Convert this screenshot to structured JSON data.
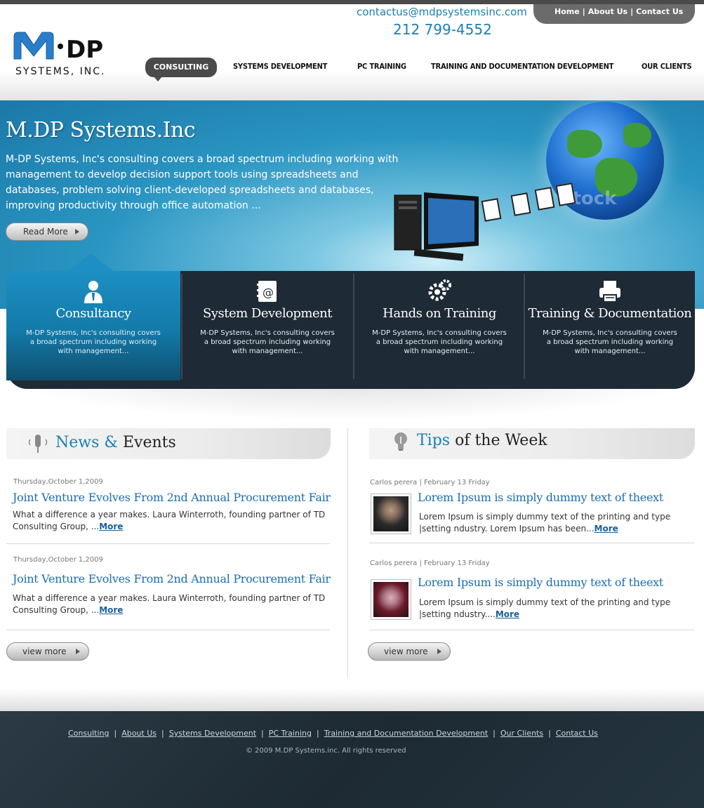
{
  "header": {
    "email": "contactus@mdpsystemsinc.com",
    "phone": "212 799-4552",
    "logo_text_top": "M·DP",
    "logo_text_bottom": "SYSTEMS, INC.",
    "top_links": [
      "Home",
      "About Us",
      "Contact Us"
    ],
    "nav": [
      "CONSULTING",
      "SYSTEMS DEVELOPMENT",
      "PC TRAINING",
      "TRAINING AND DOCUMENTATION DEVELOPMENT",
      "OUR CLIENTS"
    ]
  },
  "banner": {
    "title": "M.DP Systems.Inc",
    "text": "M-DP Systems, Inc's consulting covers a broad spectrum including working with management to develop decision support tools using spreadsheets and databases, problem solving client-developed spreadsheets and databases, improving productivity through office automation ...",
    "read_more": "Read More",
    "watermark": "stock"
  },
  "services": [
    {
      "title": "Consultancy",
      "text": "M-DP Systems, Inc's consulting covers a broad spectrum including working with management...",
      "icon": "person-icon"
    },
    {
      "title": "System Development",
      "text": "M-DP Systems, Inc's consulting covers a broad spectrum including working with management...",
      "icon": "address-book-icon"
    },
    {
      "title": "Hands on Training",
      "text": "M-DP Systems, Inc's consulting covers a broad spectrum including working with management...",
      "icon": "gears-icon"
    },
    {
      "title": "Training & Documentation",
      "text": "M-DP Systems, Inc's consulting covers a broad spectrum including working with management...",
      "icon": "printer-icon"
    }
  ],
  "news": {
    "title_highlight": "News &",
    "title_rest": " Events",
    "items": [
      {
        "date": "Thursday,October 1,2009",
        "title": "Joint Venture Evolves From 2nd Annual Procurement Fair",
        "body": "What a difference a year makes. Laura Winterroth, founding partner of TD Consulting Group, ...",
        "more": "More"
      },
      {
        "date": "Thursday,October 1,2009",
        "title": "Joint Venture Evolves From 2nd Annual Procurement Fair",
        "body": "What a difference a year makes. Laura Winterroth, founding partner of TD Consulting Group, ...",
        "more": "More"
      }
    ],
    "view_more": "view more"
  },
  "tips": {
    "title_highlight": "Tips",
    "title_rest": " of the Week",
    "items": [
      {
        "byline": "Carlos perera | February 13 Friday",
        "title": "Lorem Ipsum is simply dummy text of theext",
        "body": "Lorem Ipsum is simply dummy text of the printing and type |setting ndustry. Lorem Ipsum has been...",
        "more": "More"
      },
      {
        "byline": "Carlos perera | February 13 Friday",
        "title": "Lorem Ipsum is simply dummy text of theext",
        "body": "Lorem Ipsum is simply dummy text of the printing and type |setting ndustry....",
        "more": "More"
      }
    ],
    "view_more": "view more"
  },
  "footer": {
    "links": [
      "Consulting",
      "About Us",
      "Systems Development",
      "PC Training",
      "Training and Documentation Development",
      "Our Clients",
      "Contact Us"
    ],
    "copyright": "© 2009 M.DP Systems.inc. All rights reserved"
  },
  "colors": {
    "accent": "#1a7fb4",
    "dark_panel": "#1e2a35",
    "nav_active": "#4a4a4a"
  }
}
